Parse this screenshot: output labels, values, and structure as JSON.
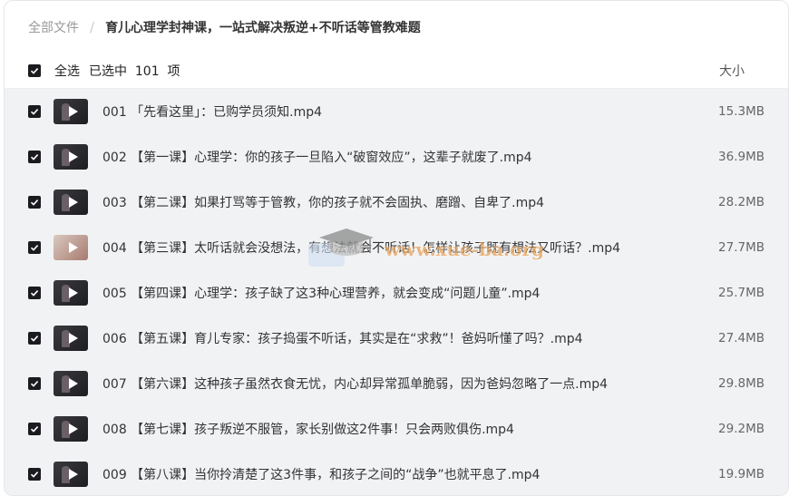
{
  "breadcrumb": {
    "root": "全部文件",
    "separator": "/",
    "current": "育儿心理学封神课，一站式解决叛逆+不听话等管教难题"
  },
  "header": {
    "select_all_label": "全选",
    "selected_count_label": "已选中  101  项",
    "size_column_label": "大小"
  },
  "files": [
    {
      "name": "001 「先看这里」：已购学员须知.mp4",
      "size": "15.3MB"
    },
    {
      "name": "002 【第一课】心理学：你的孩子一旦陷入“破窗效应”，这辈子就废了.mp4",
      "size": "36.9MB"
    },
    {
      "name": "003 【第二课】如果打骂等于管教，你的孩子就不会固执、磨蹭、自卑了.mp4",
      "size": "28.2MB"
    },
    {
      "name": "004 【第三课】太听话就会没想法，有想法就会不听话！怎样让孩子既有想法又听话？.mp4",
      "size": "27.7MB"
    },
    {
      "name": "005 【第四课】心理学：孩子缺了这3种心理营养，就会变成“问题儿童”.mp4",
      "size": "25.7MB"
    },
    {
      "name": "006 【第五课】育儿专家：孩子捣蛋不听话，其实是在“求救”！爸妈听懂了吗？.mp4",
      "size": "27.4MB"
    },
    {
      "name": "007 【第六课】这种孩子虽然衣食无忧，内心却异常孤单脆弱，因为爸妈忽略了一点.mp4",
      "size": "29.8MB"
    },
    {
      "name": "008 【第七课】孩子叛逆不服管，家长别做这2件事！只会两败俱伤.mp4",
      "size": "29.2MB"
    },
    {
      "name": "009 【第八课】当你拎清楚了这3件事，和孩子之间的“战争”也就平息了.mp4",
      "size": "19.9MB"
    }
  ],
  "watermark": {
    "text": "www.xue-ba.org"
  },
  "colors": {
    "checkbox": "#1b1b1f",
    "row_background": "#f1f2f4",
    "watermark": "#e8a45a"
  }
}
